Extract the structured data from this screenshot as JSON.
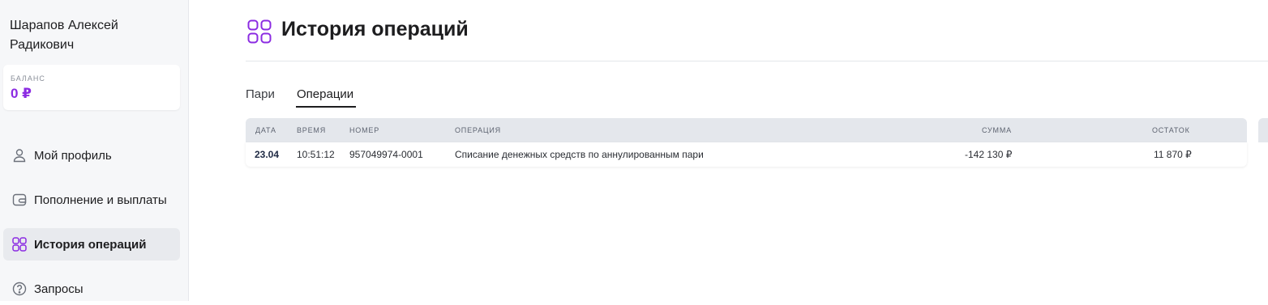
{
  "user": {
    "name": "Шарапов Алексей Радикович"
  },
  "balance": {
    "label": "БАЛАНС",
    "value": "0 ₽",
    "accent": "#8b2be2"
  },
  "sidebar": {
    "items": [
      {
        "label": "Мой профиль",
        "icon": "user-icon"
      },
      {
        "label": "Пополнение и выплаты",
        "icon": "wallet-icon"
      },
      {
        "label": "История операций",
        "icon": "grid-icon",
        "active": true
      },
      {
        "label": "Запросы",
        "icon": "help-icon"
      }
    ]
  },
  "page": {
    "title": "История операций",
    "icon": "grid-icon"
  },
  "tabs": [
    {
      "label": "Пари"
    },
    {
      "label": "Операции",
      "active": true
    }
  ],
  "table": {
    "headers": {
      "date": "ДАТА",
      "time": "ВРЕМЯ",
      "number": "НОМЕР",
      "operation": "ОПЕРАЦИЯ",
      "amount": "СУММА",
      "balance": "ОСТАТОК"
    },
    "rows": [
      {
        "date": "23.04",
        "time": "10:51:12",
        "number": "957049974-0001",
        "operation": "Списание денежных средств по аннулированным пари",
        "amount": "-142 130 ₽",
        "balance": "11 870 ₽"
      }
    ]
  }
}
